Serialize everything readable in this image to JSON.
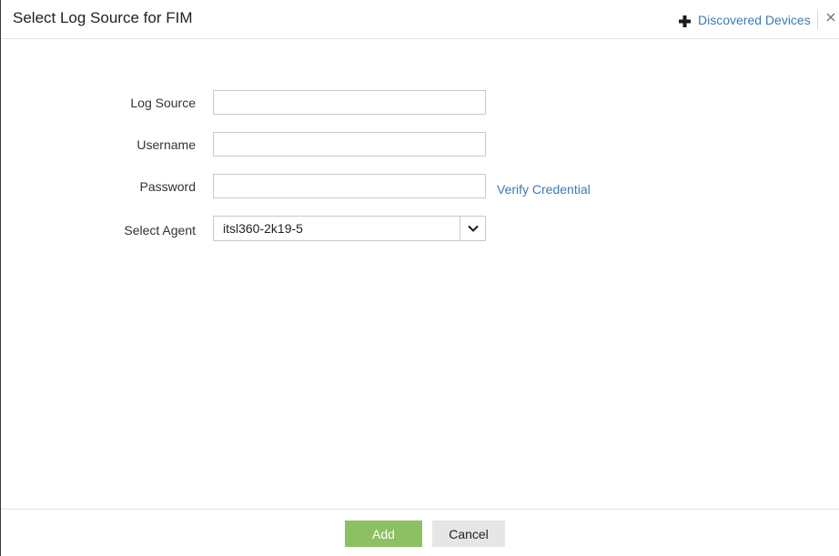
{
  "dialog": {
    "title": "Select Log Source for FIM",
    "discovered_devices_label": "Discovered Devices"
  },
  "form": {
    "log_source": {
      "label": "Log Source",
      "value": ""
    },
    "username": {
      "label": "Username",
      "value": ""
    },
    "password": {
      "label": "Password",
      "value": ""
    },
    "verify_link": "Verify Credential",
    "agent": {
      "label": "Select Agent",
      "selected": "itsl360-2k19-5"
    }
  },
  "footer": {
    "add_label": "Add",
    "cancel_label": "Cancel"
  },
  "colors": {
    "link": "#3a7bb5",
    "add_button": "#8cc063",
    "cancel_button": "#e6e6e6"
  }
}
